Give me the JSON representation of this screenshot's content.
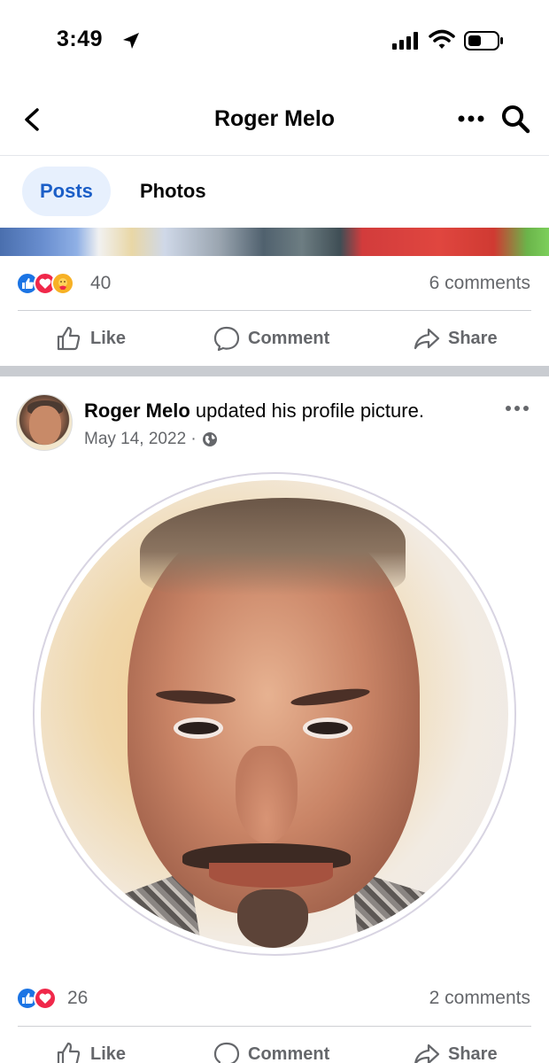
{
  "status_bar": {
    "time": "3:49"
  },
  "nav": {
    "title": "Roger Melo"
  },
  "tabs": [
    {
      "label": "Posts",
      "active": true
    },
    {
      "label": "Photos",
      "active": false
    }
  ],
  "post_previous": {
    "reactions": [
      "like",
      "love",
      "care"
    ],
    "reaction_count": "40",
    "comments": "6 comments",
    "actions": {
      "like": "Like",
      "comment": "Comment",
      "share": "Share"
    }
  },
  "post": {
    "author": "Roger Melo",
    "action_text": " updated his profile picture.",
    "date": "May 14, 2022 ·",
    "reactions": [
      "like",
      "love"
    ],
    "reaction_count": "26",
    "comments": "2 comments",
    "actions": {
      "like": "Like",
      "comment": "Comment",
      "share": "Share"
    }
  },
  "colors": {
    "accent": "#1b74e4",
    "active_tab_bg": "#e7f0fd",
    "active_tab_text": "#1b5ec7",
    "secondary_text": "#65676b",
    "love": "#f0284a",
    "care": "#f7b125"
  }
}
